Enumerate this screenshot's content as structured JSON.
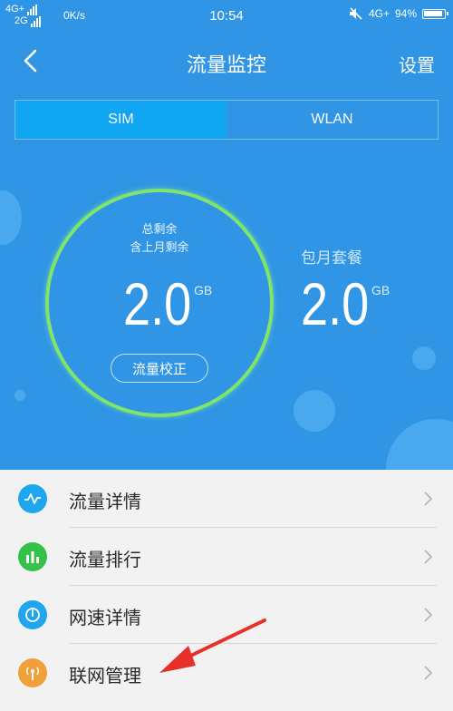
{
  "status": {
    "network_top": "4G+",
    "network_bottom": "2G",
    "speed": "0K/s",
    "time": "10:54",
    "net_right": "4G+",
    "battery": "94%"
  },
  "header": {
    "title": "流量监控",
    "settings": "设置"
  },
  "tabs": [
    {
      "label": "SIM",
      "active": true
    },
    {
      "label": "WLAN",
      "active": false
    }
  ],
  "usage": {
    "label1": "总剩余",
    "label2": "含上月剩余",
    "value": "2.0",
    "unit": "GB",
    "calibrate": "流量校正",
    "plan_label": "包月套餐",
    "plan_value": "2.0",
    "plan_unit": "GB"
  },
  "menu": [
    {
      "label": "流量详情",
      "icon": "pulse-icon",
      "color": "#1fa6ef"
    },
    {
      "label": "流量排行",
      "icon": "bar-chart-icon",
      "color": "#35c24a"
    },
    {
      "label": "网速详情",
      "icon": "speedometer-icon",
      "color": "#1fa6ef"
    },
    {
      "label": "联网管理",
      "icon": "antenna-icon",
      "color": "#f0a03a"
    }
  ],
  "colors": {
    "header_bg": "#2f95e4",
    "active_tab": "#10a6f2",
    "ring": "#7fe56a",
    "arrow": "#e8302a"
  }
}
